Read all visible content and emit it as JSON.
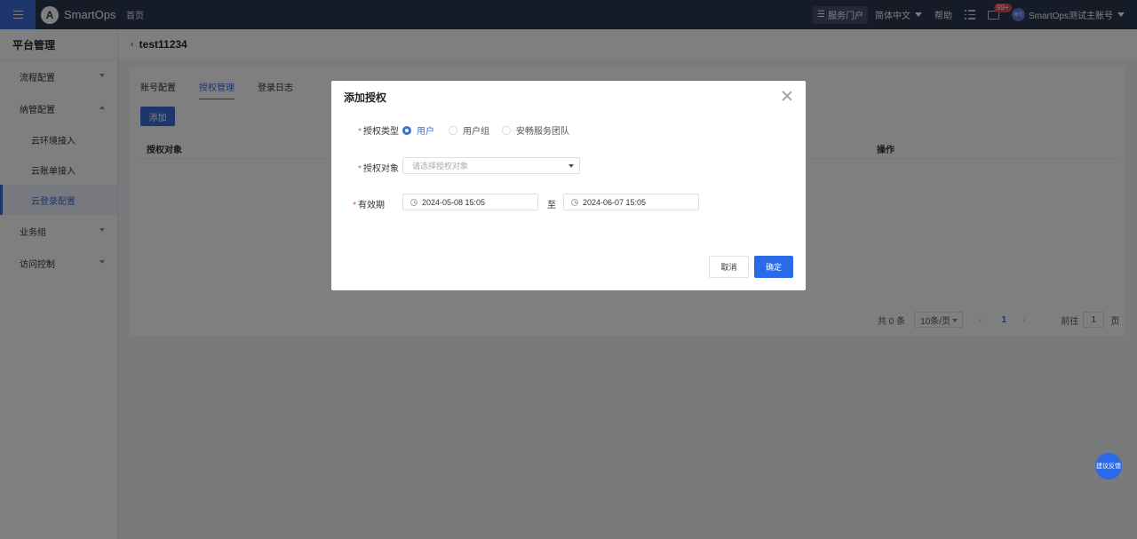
{
  "topbar": {
    "brand": "SmartOps",
    "logo_letter": "A",
    "home": "首页",
    "portal": "服务门户",
    "language": "简体中文",
    "help": "帮助",
    "mail_badge": "99+",
    "avatar_text": "账号",
    "account": "SmartOps测试主账号"
  },
  "sidebar": {
    "title": "平台管理",
    "groups": [
      {
        "label": "流程配置",
        "expanded": false
      },
      {
        "label": "纳管配置",
        "expanded": true,
        "items": [
          {
            "label": "云环境接入"
          },
          {
            "label": "云账单接入"
          },
          {
            "label": "云登录配置",
            "active": true
          }
        ]
      },
      {
        "label": "业务组",
        "expanded": false
      },
      {
        "label": "访问控制",
        "expanded": false
      }
    ]
  },
  "page": {
    "back": "‹",
    "title": "test11234",
    "tabs": [
      {
        "label": "账号配置"
      },
      {
        "label": "授权管理",
        "active": true
      },
      {
        "label": "登录日志"
      }
    ],
    "add_button": "添加",
    "table": {
      "columns": [
        "授权对象",
        "操作"
      ]
    },
    "pagination": {
      "total": "共 0 条",
      "page_size": "10条/页",
      "prev": "‹",
      "current": "1",
      "next": "›",
      "goto": "前往",
      "goto_value": "1",
      "unit": "页"
    }
  },
  "feedback_button": "建议反馈",
  "dialog": {
    "title": "添加授权",
    "type_label": "授权类型",
    "options": [
      {
        "label": "用户",
        "checked": true
      },
      {
        "label": "用户组",
        "checked": false
      },
      {
        "label": "安畅服务团队",
        "checked": false
      }
    ],
    "target_label": "授权对象",
    "target_placeholder": "请选择授权对象",
    "validity_label": "有效期",
    "start_date": "2024-05-08 15:05",
    "to": "至",
    "end_date": "2024-06-07 15:05",
    "cancel": "取消",
    "confirm": "确定"
  },
  "colors": {
    "accent": "#3a6fd8",
    "topbar": "#2d3650",
    "primary_button": "#2a6ae8",
    "required": "#e34d59"
  }
}
